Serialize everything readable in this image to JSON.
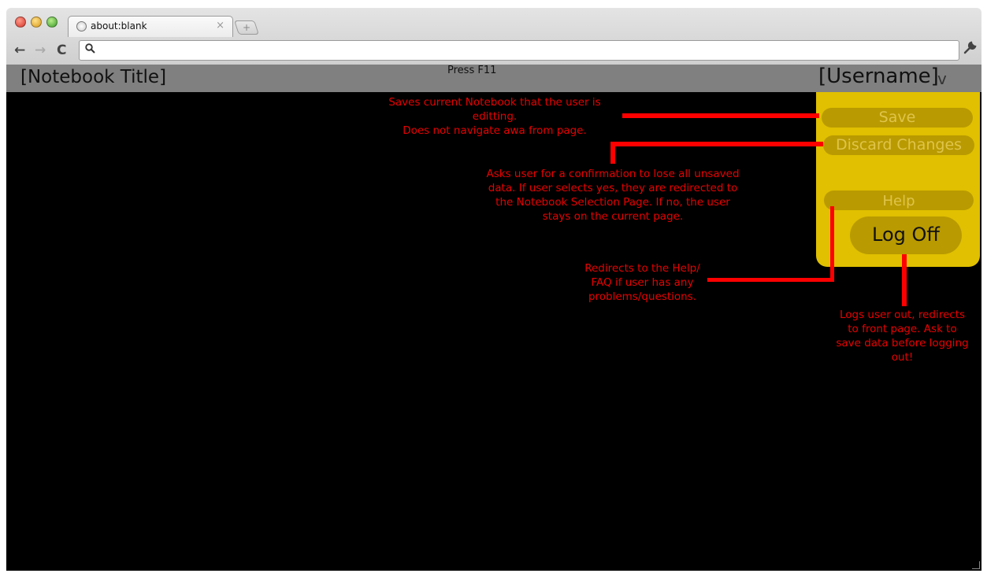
{
  "browser": {
    "tab_title": "about:blank",
    "tab_close": "×",
    "new_tab": "+",
    "back": "←",
    "forward": "→",
    "reload": "C",
    "search_icon": "search-icon",
    "wrench_icon": "wrench-icon",
    "omnibox_value": ""
  },
  "app": {
    "notebook_title": "[Notebook Title]",
    "press_hint": "Press F11",
    "username": "[Username]",
    "user_caret": "v"
  },
  "menu": {
    "save": "Save",
    "discard": "Discard Changes",
    "help": "Help",
    "logoff": "Log Off",
    "panel_color": "#e0c000",
    "button_color": "#b99a00"
  },
  "annotations": {
    "save": [
      "Saves current Notebook that the user is editting.",
      "Does not navigate awa from page."
    ],
    "discard": [
      "Asks user for a confirmation to lose all unsaved",
      "data.  If user selects yes, they are redirected to",
      "the Notebook Selection Page.  If no, the user",
      "stays on the current page."
    ],
    "help": [
      "Redirects to the Help/",
      "FAQ if user has any",
      "problems/questions."
    ],
    "logoff": [
      "Logs user out, redirects",
      "to front page. Ask to",
      "save data before logging",
      "out!"
    ],
    "color": "#e80000"
  }
}
